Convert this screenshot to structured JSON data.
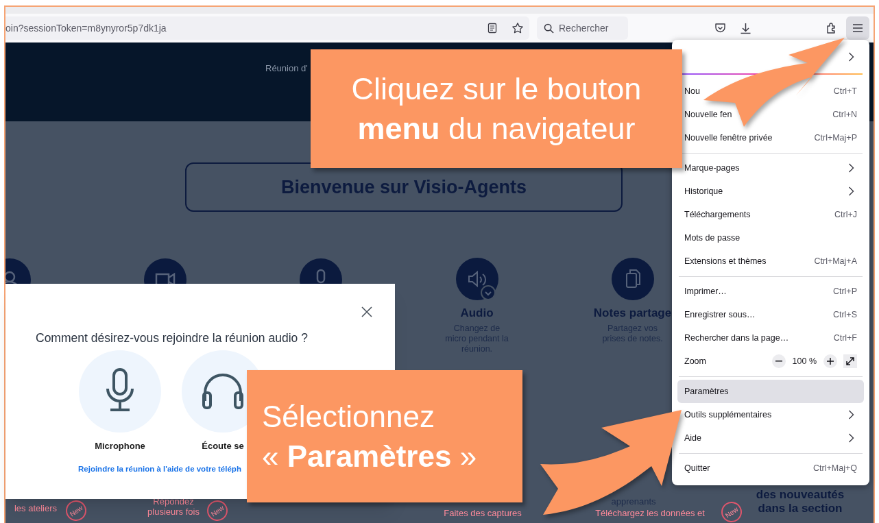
{
  "toolbar": {
    "url": "oin?sessionToken=m8ynyror5p7dk1ja",
    "search_placeholder": "Rechercher"
  },
  "page": {
    "header_text": "Réunion d'",
    "welcome": "Bienvenue sur Visio-Agents",
    "features": [
      {
        "title": "Audio",
        "description": "Changez de micro pendant la réunion."
      },
      {
        "title": "Notes partage",
        "description": "Partagez vos prises de notes."
      }
    ],
    "bottom_texts": [
      {
        "text": "les ateliers",
        "kind": "red",
        "badge": "New"
      },
      {
        "text": "Répondez plusieurs fois",
        "kind": "red",
        "badge": "New"
      },
      {
        "text": "Faites des captures",
        "kind": "red"
      },
      {
        "text": "apprenants",
        "kind": "plain"
      },
      {
        "text": "Téléchargez les données et",
        "kind": "red",
        "badge": "New"
      },
      {
        "text": "des nouveautés dans la section",
        "kind": "bold"
      }
    ]
  },
  "dialog": {
    "title": "Comment désirez-vous rejoindre la réunion audio ?",
    "options": [
      {
        "label": "Microphone"
      },
      {
        "label": "Écoute se"
      }
    ],
    "link": "Rejoindre la réunion à l'aide de votre téléph"
  },
  "menu": {
    "items": [
      {
        "kind": "item",
        "submenu": true,
        "highlighted": false
      },
      {
        "kind": "accent"
      },
      {
        "kind": "item",
        "label": "Nou",
        "shortcut": "Ctrl+T",
        "submenu": false,
        "highlighted": false
      },
      {
        "kind": "item",
        "label": "Nouvelle fen",
        "shortcut": "Ctrl+N",
        "submenu": false,
        "highlighted": false
      },
      {
        "kind": "item",
        "label": "Nouvelle fenêtre privée",
        "shortcut": "Ctrl+Maj+P",
        "submenu": false,
        "highlighted": false
      },
      {
        "kind": "separator"
      },
      {
        "kind": "item",
        "label": "Marque-pages",
        "submenu": true,
        "highlighted": false
      },
      {
        "kind": "item",
        "label": "Historique",
        "submenu": true,
        "highlighted": false
      },
      {
        "kind": "item",
        "label": "Téléchargements",
        "shortcut": "Ctrl+J",
        "submenu": false,
        "highlighted": false
      },
      {
        "kind": "item",
        "label": "Mots de passe",
        "submenu": false,
        "highlighted": false
      },
      {
        "kind": "item",
        "label": "Extensions et thèmes",
        "shortcut": "Ctrl+Maj+A",
        "submenu": false,
        "highlighted": false
      },
      {
        "kind": "separator"
      },
      {
        "kind": "item",
        "label": "Imprimer…",
        "shortcut": "Ctrl+P",
        "submenu": false,
        "highlighted": false
      },
      {
        "kind": "item",
        "label": "Enregistrer sous…",
        "shortcut": "Ctrl+S",
        "submenu": false,
        "highlighted": false
      },
      {
        "kind": "item",
        "label": "Rechercher dans la page…",
        "shortcut": "Ctrl+F",
        "submenu": false,
        "highlighted": false
      },
      {
        "kind": "zoom",
        "label": "Zoom",
        "value": "100 %"
      },
      {
        "kind": "separator"
      },
      {
        "kind": "item",
        "label": "Paramètres",
        "submenu": false,
        "highlighted": true
      },
      {
        "kind": "item",
        "label": "Outils supplémentaires",
        "submenu": true,
        "highlighted": false
      },
      {
        "kind": "item",
        "label": "Aide",
        "submenu": true,
        "highlighted": false
      },
      {
        "kind": "separator"
      },
      {
        "kind": "item",
        "label": "Quitter",
        "shortcut": "Ctrl+Maj+Q",
        "submenu": false,
        "highlighted": false
      }
    ]
  },
  "callouts": [
    {
      "text": "Cliquez sur le bouton **menu** du navigateur"
    },
    {
      "text": "Sélectionnez « **Paramètres** »"
    }
  ]
}
